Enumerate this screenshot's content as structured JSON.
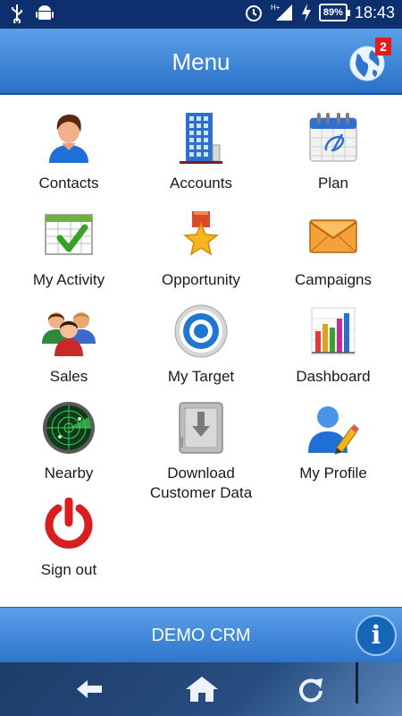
{
  "status_bar": {
    "time": "18:43",
    "battery": "89%",
    "icons": [
      "usb-icon",
      "android-icon",
      "alarm-icon",
      "signal-icon",
      "charging-icon",
      "battery-icon"
    ]
  },
  "header": {
    "title": "Menu",
    "notification_count": "2"
  },
  "menu": {
    "items": [
      {
        "label": "Contacts",
        "icon": "contact-person-icon"
      },
      {
        "label": "Accounts",
        "icon": "building-icon"
      },
      {
        "label": "Plan",
        "icon": "calendar-icon"
      },
      {
        "label": "My Activity",
        "icon": "checklist-icon"
      },
      {
        "label": "Opportunity",
        "icon": "medal-star-icon"
      },
      {
        "label": "Campaigns",
        "icon": "envelope-icon"
      },
      {
        "label": "Sales",
        "icon": "people-group-icon"
      },
      {
        "label": "My Target",
        "icon": "target-icon"
      },
      {
        "label": "Dashboard",
        "icon": "bar-chart-icon"
      },
      {
        "label": "Nearby",
        "icon": "radar-icon"
      },
      {
        "label": "Download\nCustomer Data",
        "line1": "Download",
        "line2": "Customer Data",
        "icon": "download-box-icon"
      },
      {
        "label": "My Profile",
        "icon": "profile-edit-icon"
      },
      {
        "label": "Sign out",
        "icon": "power-icon"
      }
    ]
  },
  "footer": {
    "title": "DEMO CRM"
  },
  "nav": {
    "icons": [
      "back-arrow-icon",
      "home-icon",
      "refresh-icon"
    ]
  },
  "colors": {
    "status_bar": "#0d2f6e",
    "app_bar": "#3b86d8",
    "accent": "#1565b8",
    "badge": "#e21b1b"
  }
}
